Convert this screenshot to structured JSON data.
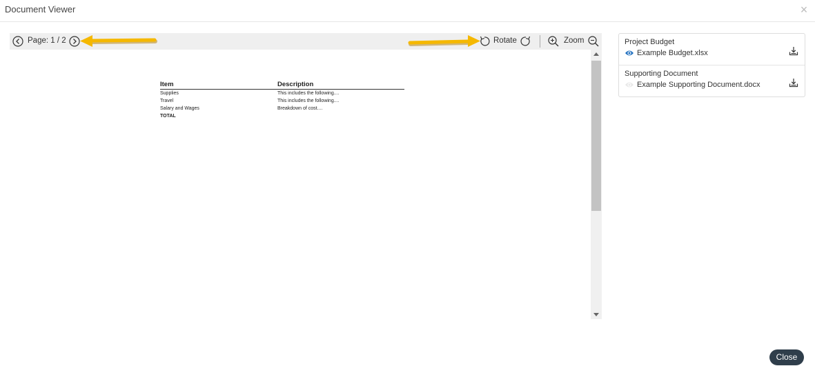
{
  "dialog": {
    "title": "Document Viewer",
    "close_icon": "close-icon",
    "close_button_label": "Close"
  },
  "toolbar": {
    "page_label": "Page: 1 / 2",
    "rotate_label": "Rotate",
    "zoom_label": "Zoom",
    "icons": [
      "prev-page-icon",
      "next-page-icon",
      "rotate-left-icon",
      "rotate-right-icon",
      "zoom-in-icon",
      "zoom-out-icon"
    ]
  },
  "document": {
    "headers": [
      "Item",
      "Description"
    ],
    "rows": [
      [
        "Supplies",
        "This includes the following...."
      ],
      [
        "Travel",
        "This includes the following...."
      ],
      [
        "Salary and Wages",
        "Breakdown of cost...."
      ],
      [
        "TOTAL",
        ""
      ]
    ]
  },
  "files": [
    {
      "category": "Project Budget",
      "name": "Example Budget.xlsx",
      "viewing": true
    },
    {
      "category": "Supporting Document",
      "name": "Example Supporting Document.docx",
      "viewing": false
    }
  ],
  "colors": {
    "accent": "#1f6fbf",
    "annotation_arrow": "#f5b800",
    "close_button": "#2f3e4b"
  }
}
